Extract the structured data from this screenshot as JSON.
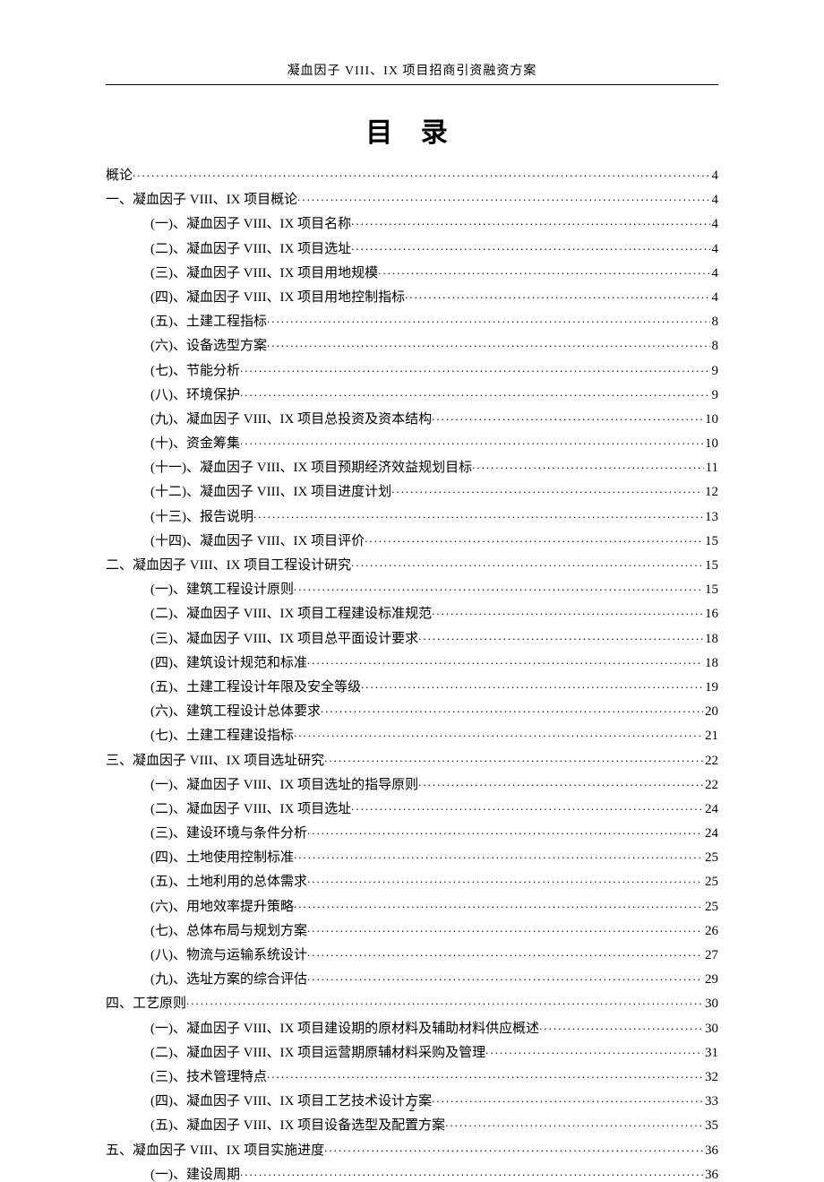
{
  "header": "凝血因子 VIII、IX 项目招商引资融资方案",
  "toc_title": "目 录",
  "page_number": "2",
  "entries": [
    {
      "level": 0,
      "label": "概论",
      "page": "4"
    },
    {
      "level": 1,
      "label": "一、凝血因子 VIII、IX 项目概论",
      "page": "4"
    },
    {
      "level": 2,
      "label": "(一)、凝血因子 VIII、IX 项目名称",
      "page": "4"
    },
    {
      "level": 2,
      "label": "(二)、凝血因子 VIII、IX 项目选址",
      "page": "4"
    },
    {
      "level": 2,
      "label": "(三)、凝血因子 VIII、IX 项目用地规模",
      "page": "4"
    },
    {
      "level": 2,
      "label": "(四)、凝血因子 VIII、IX 项目用地控制指标",
      "page": "4"
    },
    {
      "level": 2,
      "label": "(五)、土建工程指标",
      "page": "8"
    },
    {
      "level": 2,
      "label": "(六)、设备选型方案",
      "page": "8"
    },
    {
      "level": 2,
      "label": "(七)、节能分析",
      "page": "9"
    },
    {
      "level": 2,
      "label": "(八)、环境保护",
      "page": "9"
    },
    {
      "level": 2,
      "label": "(九)、凝血因子 VIII、IX 项目总投资及资本结构",
      "page": "10"
    },
    {
      "level": 2,
      "label": "(十)、资金筹集",
      "page": "10"
    },
    {
      "level": 2,
      "label": "(十一)、凝血因子 VIII、IX 项目预期经济效益规划目标",
      "page": "11"
    },
    {
      "level": 2,
      "label": "(十二)、凝血因子 VIII、IX 项目进度计划",
      "page": "12"
    },
    {
      "level": 2,
      "label": "(十三)、报告说明",
      "page": "13"
    },
    {
      "level": 2,
      "label": "(十四)、凝血因子 VIII、IX 项目评价",
      "page": "15"
    },
    {
      "level": 1,
      "label": "二、凝血因子 VIII、IX 项目工程设计研究",
      "page": "15"
    },
    {
      "level": 2,
      "label": "(一)、建筑工程设计原则",
      "page": "15"
    },
    {
      "level": 2,
      "label": "(二)、凝血因子 VIII、IX 项目工程建设标准规范",
      "page": "16"
    },
    {
      "level": 2,
      "label": "(三)、凝血因子 VIII、IX 项目总平面设计要求",
      "page": "18"
    },
    {
      "level": 2,
      "label": "(四)、建筑设计规范和标准",
      "page": "18"
    },
    {
      "level": 2,
      "label": "(五)、土建工程设计年限及安全等级",
      "page": "19"
    },
    {
      "level": 2,
      "label": "(六)、建筑工程设计总体要求",
      "page": "20"
    },
    {
      "level": 2,
      "label": "(七)、土建工程建设指标",
      "page": "21"
    },
    {
      "level": 1,
      "label": "三、凝血因子 VIII、IX 项目选址研究",
      "page": "22"
    },
    {
      "level": 2,
      "label": "(一)、凝血因子 VIII、IX 项目选址的指导原则",
      "page": "22"
    },
    {
      "level": 2,
      "label": "(二)、凝血因子 VIII、IX 项目选址",
      "page": "24"
    },
    {
      "level": 2,
      "label": "(三)、建设环境与条件分析",
      "page": "24"
    },
    {
      "level": 2,
      "label": "(四)、土地使用控制标准",
      "page": "25"
    },
    {
      "level": 2,
      "label": "(五)、土地利用的总体需求",
      "page": "25"
    },
    {
      "level": 2,
      "label": "(六)、用地效率提升策略",
      "page": "25"
    },
    {
      "level": 2,
      "label": "(七)、总体布局与规划方案",
      "page": "26"
    },
    {
      "level": 2,
      "label": "(八)、物流与运输系统设计",
      "page": "27"
    },
    {
      "level": 2,
      "label": "(九)、选址方案的综合评估",
      "page": "29"
    },
    {
      "level": 1,
      "label": "四、工艺原则",
      "page": "30"
    },
    {
      "level": 2,
      "label": "(一)、凝血因子 VIII、IX 项目建设期的原材料及辅助材料供应概述",
      "page": "30"
    },
    {
      "level": 2,
      "label": "(二)、凝血因子 VIII、IX 项目运营期原辅材料采购及管理",
      "page": "31"
    },
    {
      "level": 2,
      "label": "(三)、技术管理特点",
      "page": "32"
    },
    {
      "level": 2,
      "label": "(四)、凝血因子 VIII、IX 项目工艺技术设计方案",
      "page": "33"
    },
    {
      "level": 2,
      "label": "(五)、凝血因子 VIII、IX 项目设备选型及配置方案",
      "page": "35"
    },
    {
      "level": 1,
      "label": "五、凝血因子 VIII、IX 项目实施进度",
      "page": "36"
    },
    {
      "level": 2,
      "label": "(一)、建设周期",
      "page": "36"
    }
  ]
}
